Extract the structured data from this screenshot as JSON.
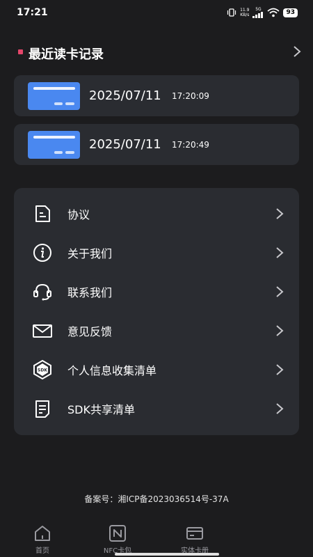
{
  "status_bar": {
    "time": "17:21",
    "net_speed_value": "11.9",
    "net_speed_unit": "KB/s",
    "net_type": "5G",
    "battery": "93"
  },
  "recent": {
    "title": "最近读卡记录",
    "records": [
      {
        "date": "2025/07/11",
        "time": "17:20:09"
      },
      {
        "date": "2025/07/11",
        "time": "17:20:49"
      }
    ]
  },
  "menu": {
    "items": [
      {
        "label": "协议",
        "icon": "document-icon"
      },
      {
        "label": "关于我们",
        "icon": "info-icon"
      },
      {
        "label": "联系我们",
        "icon": "headset-icon"
      },
      {
        "label": "意见反馈",
        "icon": "mail-icon"
      },
      {
        "label": "个人信息收集清单",
        "icon": "sdk-icon"
      },
      {
        "label": "SDK共享清单",
        "icon": "list-doc-icon"
      }
    ]
  },
  "footer": {
    "icp": "备案号：湘ICP备2023036514号-37A"
  },
  "bottom_nav": {
    "items": [
      {
        "label": "首页",
        "icon": "home-icon"
      },
      {
        "label": "NFC卡包",
        "icon": "nfc-icon"
      },
      {
        "label": "实体卡册",
        "icon": "card-icon"
      }
    ]
  },
  "colors": {
    "background": "#1c1c1e",
    "card": "#2a2c31",
    "accent_dot": "#e5466a",
    "card_thumb": "#4a88f0"
  }
}
